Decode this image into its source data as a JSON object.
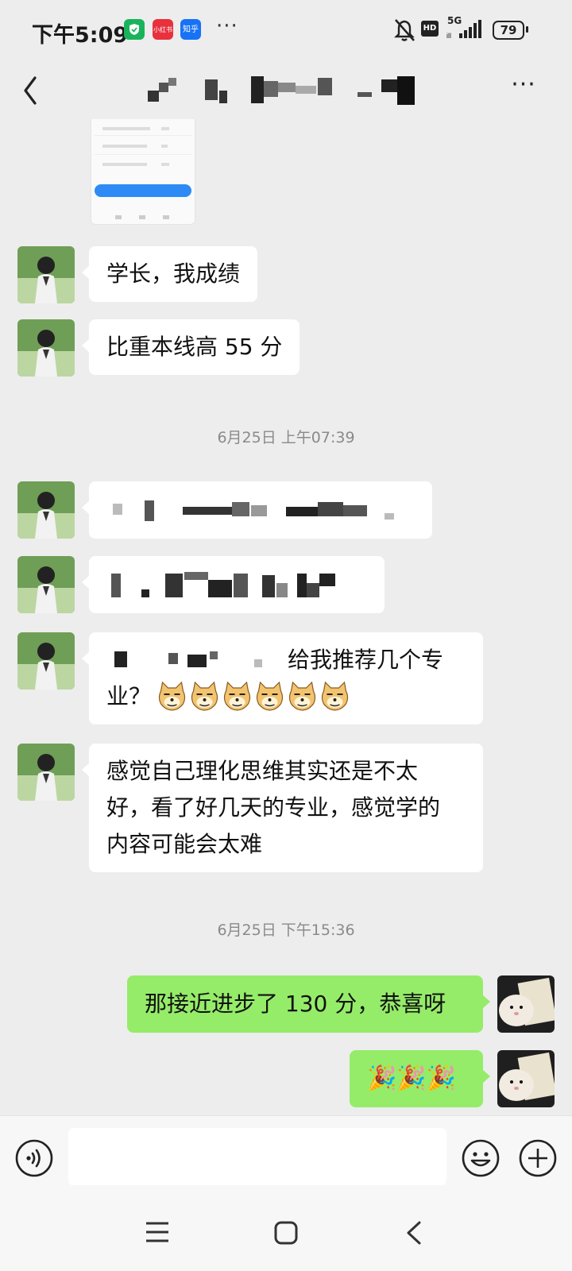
{
  "status_bar": {
    "time": "下午5:09",
    "apps": [
      "小红书",
      "知乎"
    ],
    "network": "5G",
    "hd": "HD",
    "battery": "79"
  },
  "header": {
    "title": "",
    "more": "···"
  },
  "messages": [
    {
      "side": "left",
      "text": "学长，我成绩"
    },
    {
      "side": "left",
      "text": "比重本线高 55 分"
    },
    {
      "timestamp": "6月25日 上午07:39"
    },
    {
      "side": "left",
      "text": ""
    },
    {
      "side": "left",
      "text": ""
    },
    {
      "side": "left",
      "text_line1": "给我推荐几个专",
      "text_line2": "业？"
    },
    {
      "side": "left",
      "lines": [
        "感觉自己理化思维其实还是不太",
        "好，看了好几天的专业，感觉学的",
        "内容可能会太难"
      ]
    },
    {
      "timestamp": "6月25日 下午15:36"
    },
    {
      "side": "right",
      "text": "那接近进步了 130 分，恭喜呀"
    },
    {
      "side": "right",
      "emoji": "🎉🎉🎉"
    }
  ],
  "input": {
    "placeholder": "",
    "voice_icon": "voice-icon",
    "emoji_icon": "smiley-icon",
    "plus_icon": "plus-icon"
  },
  "colors": {
    "background": "#ededed",
    "my_bubble": "#95ec69",
    "other_bubble": "#ffffff",
    "timestamp": "#8a8a8a"
  }
}
